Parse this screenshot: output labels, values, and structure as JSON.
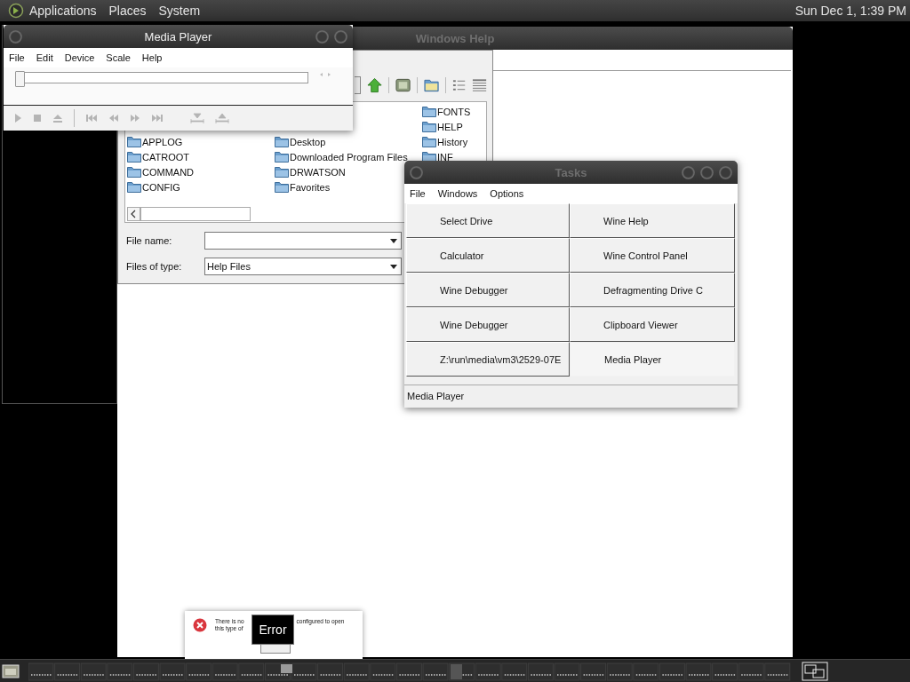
{
  "top_panel": {
    "menus": [
      "Applications",
      "Places",
      "System"
    ],
    "clock": "Sun Dec 1, 1:39 PM"
  },
  "windows_help": {
    "title": "Windows Help",
    "active": false
  },
  "open_dialog": {
    "folder_columns": [
      [
        "APPLOG",
        "CATROOT",
        "COMMAND",
        "CONFIG"
      ],
      [
        "Desktop",
        "Downloaded Program Files",
        "DRWATSON",
        "Favorites"
      ],
      [
        "FONTS",
        "HELP",
        "History",
        "INF"
      ]
    ],
    "file_name_label": "File name:",
    "files_of_type_label": "Files of type:",
    "files_of_type": "Help Files"
  },
  "media_player": {
    "title": "Media Player",
    "active": true,
    "menus": [
      "File",
      "Edit",
      "Device",
      "Scale",
      "Help"
    ],
    "position": {
      "level": 0
    },
    "controls_disabled": true
  },
  "tasks": {
    "title": "Tasks",
    "active": false,
    "menus": [
      "File",
      "Windows",
      "Options"
    ],
    "buttons": [
      {
        "label": "Select Drive",
        "selected": false
      },
      {
        "label": "Wine Help",
        "selected": false
      },
      {
        "label": "Calculator",
        "selected": false
      },
      {
        "label": "Wine Control Panel",
        "selected": false
      },
      {
        "label": "Wine Debugger",
        "selected": false
      },
      {
        "label": "Defragmenting Drive C",
        "selected": false
      },
      {
        "label": "Wine Debugger",
        "selected": false
      },
      {
        "label": "Clipboard Viewer",
        "selected": false
      },
      {
        "label": "Z:\\run\\media\\vm3\\2529-07E",
        "selected": false
      },
      {
        "label": "Media Player",
        "selected": true
      }
    ],
    "status": "Media Player"
  },
  "error_dialog": {
    "line_1_left": "There is no",
    "line_1_right": "configured to open",
    "line_2": "this type of",
    "tooltip": "Error"
  }
}
